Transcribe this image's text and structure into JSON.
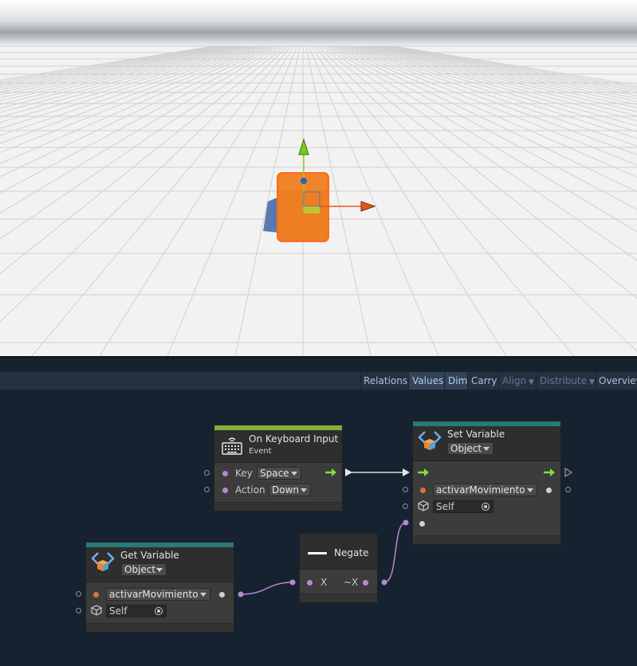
{
  "toolbar": {
    "items": [
      {
        "label": "Relations",
        "state": "normal"
      },
      {
        "label": "Values",
        "state": "active"
      },
      {
        "label": "Dim",
        "state": "active"
      },
      {
        "label": "Carry",
        "state": "normal"
      },
      {
        "label": "Align",
        "state": "disabled",
        "dropdown": true
      },
      {
        "label": "Distribute",
        "state": "disabled",
        "dropdown": true
      },
      {
        "label": "Overview",
        "state": "normal"
      }
    ]
  },
  "nodes": {
    "keyboard": {
      "title": "On Keyboard Input",
      "subtitle": "Event",
      "key_label": "Key",
      "key_value": "Space",
      "action_label": "Action",
      "action_value": "Down",
      "accent": "#7fb13a"
    },
    "set_variable": {
      "title": "Set Variable",
      "kind": "Object",
      "name_value": "activarMovimiento",
      "target_value": "Self",
      "accent": "#2a7a76"
    },
    "get_variable": {
      "title": "Get Variable",
      "kind": "Object",
      "name_value": "activarMovimiento",
      "target_value": "Self",
      "accent": "#2a7a76"
    },
    "negate": {
      "title": "Negate",
      "input_label": "X",
      "output_label": "~X"
    }
  },
  "colors": {
    "flow_arrow": "#7fe03a",
    "value_port": "#b888d0",
    "required_port": "#e0713c",
    "wire": "#b888d0"
  }
}
